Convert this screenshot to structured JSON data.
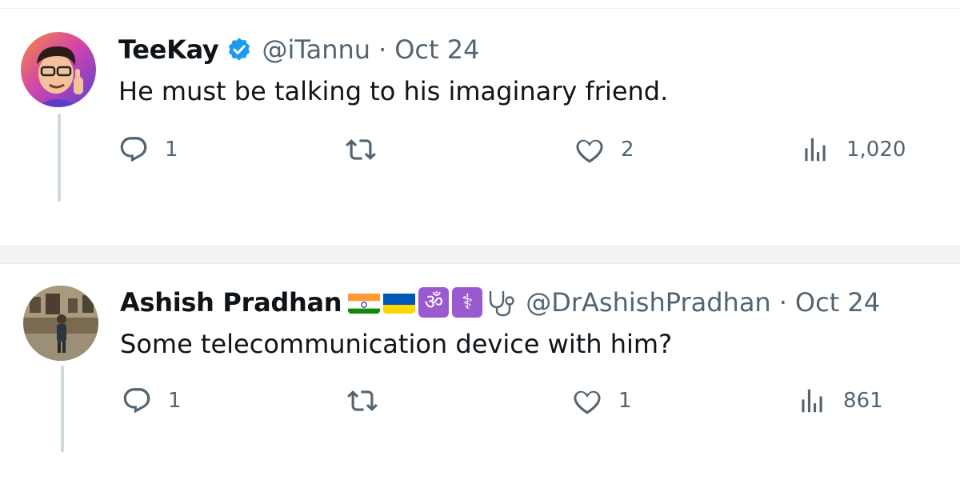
{
  "tweets": [
    {
      "name": "TeeKay",
      "verified": true,
      "handle": "@iTannu",
      "date": "Oct 24",
      "text": "He must be talking to his imaginary friend.",
      "replies": "1",
      "retweets": "",
      "likes": "2",
      "views": "1,020"
    },
    {
      "name": "Ashish Pradhan",
      "name_emojis": [
        "flag-india-icon",
        "flag-ukraine-icon",
        "om-symbol-icon",
        "medical-symbol-icon",
        "stethoscope-icon"
      ],
      "handle": "@DrAshishPradhan",
      "date": "Oct 24",
      "text": "Some telecommunication device with him?",
      "replies": "1",
      "retweets": "",
      "likes": "1",
      "views": "861"
    }
  ],
  "colors": {
    "text_primary": "#0f1419",
    "text_secondary": "#536471",
    "verified_blue": "#1d9bf0",
    "thread_line": "#cfd9de",
    "separator": "#f2f3f4"
  }
}
